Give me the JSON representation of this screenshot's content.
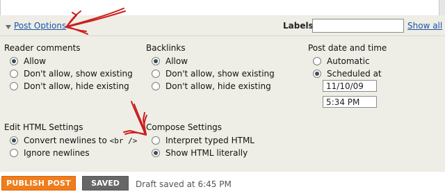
{
  "post_options": {
    "link_label": "Post Options",
    "labels_label": "Labels:",
    "labels_value": "",
    "show_all_label": "Show all"
  },
  "reader_comments": {
    "title": "Reader comments",
    "options": [
      "Allow",
      "Don't allow, show existing",
      "Don't allow, hide existing"
    ],
    "selected": 0
  },
  "backlinks": {
    "title": "Backlinks",
    "options": [
      "Allow",
      "Don't allow, show existing",
      "Don't allow, hide existing"
    ],
    "selected": 0
  },
  "post_date": {
    "title": "Post date and time",
    "options": [
      "Automatic",
      "Scheduled at"
    ],
    "selected": 1,
    "date": "11/10/09",
    "time": "5:34 PM"
  },
  "edit_html": {
    "title": "Edit HTML Settings",
    "convert_prefix": "Convert newlines to ",
    "convert_code": "<br />",
    "ignore_label": "Ignore newlines",
    "selected": 0
  },
  "compose": {
    "title": "Compose Settings",
    "options": [
      "Interpret typed HTML",
      "Show HTML literally"
    ],
    "selected": 1
  },
  "actions": {
    "publish_label": "PUBLISH POST",
    "saved_label": "SAVED",
    "status_text": "Draft saved at 6:45 PM"
  },
  "colors": {
    "panel_bg": "#eeeee6",
    "publish_bg": "#f07c1b",
    "saved_bg": "#666666",
    "link": "#1c52a8",
    "annotation": "#cc1d1d"
  }
}
